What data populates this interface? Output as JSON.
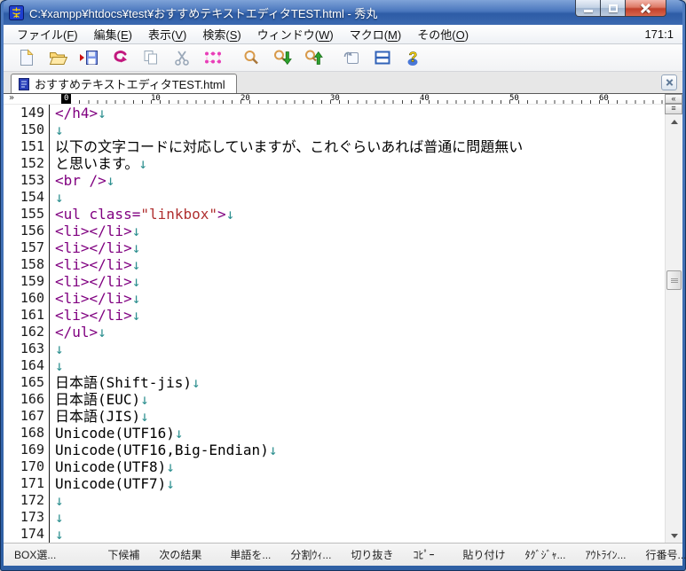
{
  "titlebar": {
    "title": "C:¥xampp¥htdocs¥test¥おすすめテキストエディタTEST.html  - 秀丸"
  },
  "menu": {
    "items": [
      {
        "id": "file",
        "pre": "ファイル(",
        "key": "F",
        "post": ")"
      },
      {
        "id": "edit",
        "pre": "編集(",
        "key": "E",
        "post": ")"
      },
      {
        "id": "view",
        "pre": "表示(",
        "key": "V",
        "post": ")"
      },
      {
        "id": "search",
        "pre": "検索(",
        "key": "S",
        "post": ")"
      },
      {
        "id": "window",
        "pre": "ウィンドウ(",
        "key": "W",
        "post": ")"
      },
      {
        "id": "macro",
        "pre": "マクロ(",
        "key": "M",
        "post": ")"
      },
      {
        "id": "other",
        "pre": "その他(",
        "key": "O",
        "post": ")"
      }
    ],
    "cursor_position": "171:1"
  },
  "toolbar": {
    "icons": [
      "new-file",
      "open-folder",
      "save",
      "undo",
      "copy",
      "cut",
      "box-select",
      "search",
      "search-down",
      "search-up",
      "tag-jump",
      "split-window",
      "help"
    ]
  },
  "tabbar": {
    "active_tab": "おすすめテキストエディタTEST.html"
  },
  "ruler": {
    "marks": [
      0,
      10,
      20,
      30,
      40,
      50,
      60
    ]
  },
  "editor": {
    "newline_glyph": "↓",
    "lines": [
      {
        "num": 149,
        "seg": [
          {
            "t": "</h4>",
            "c": "tag"
          }
        ],
        "nl": true
      },
      {
        "num": 150,
        "seg": [],
        "nl": true
      },
      {
        "num": 151,
        "seg": [
          {
            "t": "以下の文字コードに対応していますが、これぐらいあれば普通に問題無い",
            "c": "txt"
          }
        ],
        "nl": false
      },
      {
        "num": 152,
        "seg": [
          {
            "t": "と思います。",
            "c": "txt"
          }
        ],
        "nl": true
      },
      {
        "num": 153,
        "seg": [
          {
            "t": "<br />",
            "c": "tag"
          }
        ],
        "nl": true
      },
      {
        "num": 154,
        "seg": [],
        "nl": true
      },
      {
        "num": 155,
        "seg": [
          {
            "t": "<ul class=",
            "c": "tag"
          },
          {
            "t": "\"linkbox\"",
            "c": "str"
          },
          {
            "t": ">",
            "c": "tag"
          }
        ],
        "nl": true
      },
      {
        "num": 156,
        "seg": [
          {
            "t": "<li></li>",
            "c": "tag"
          }
        ],
        "nl": true
      },
      {
        "num": 157,
        "seg": [
          {
            "t": "<li></li>",
            "c": "tag"
          }
        ],
        "nl": true
      },
      {
        "num": 158,
        "seg": [
          {
            "t": "<li></li>",
            "c": "tag"
          }
        ],
        "nl": true
      },
      {
        "num": 159,
        "seg": [
          {
            "t": "<li></li>",
            "c": "tag"
          }
        ],
        "nl": true
      },
      {
        "num": 160,
        "seg": [
          {
            "t": "<li></li>",
            "c": "tag"
          }
        ],
        "nl": true
      },
      {
        "num": 161,
        "seg": [
          {
            "t": "<li></li>",
            "c": "tag"
          }
        ],
        "nl": true
      },
      {
        "num": 162,
        "seg": [
          {
            "t": "</ul>",
            "c": "tag"
          }
        ],
        "nl": true
      },
      {
        "num": 163,
        "seg": [],
        "nl": true
      },
      {
        "num": 164,
        "seg": [],
        "nl": true
      },
      {
        "num": 165,
        "seg": [
          {
            "t": "日本語(Shift-jis)",
            "c": "txt"
          }
        ],
        "nl": true
      },
      {
        "num": 166,
        "seg": [
          {
            "t": "日本語(EUC)",
            "c": "txt"
          }
        ],
        "nl": true
      },
      {
        "num": 167,
        "seg": [
          {
            "t": "日本語(JIS)",
            "c": "txt"
          }
        ],
        "nl": true
      },
      {
        "num": 168,
        "seg": [
          {
            "t": "Unicode(UTF16)",
            "c": "txt"
          }
        ],
        "nl": true
      },
      {
        "num": 169,
        "seg": [
          {
            "t": "Unicode(UTF16,Big-Endian)",
            "c": "txt"
          }
        ],
        "nl": true
      },
      {
        "num": 170,
        "seg": [
          {
            "t": "Unicode(UTF8)",
            "c": "txt"
          }
        ],
        "nl": true
      },
      {
        "num": 171,
        "seg": [
          {
            "t": "Unicode(UTF7)",
            "c": "txt"
          }
        ],
        "nl": true
      },
      {
        "num": 172,
        "seg": [],
        "nl": true
      },
      {
        "num": 173,
        "seg": [],
        "nl": true
      },
      {
        "num": 174,
        "seg": [],
        "nl": true
      }
    ]
  },
  "statusbar": {
    "items": [
      "BOX選...",
      "下候補",
      "次の結果",
      "|",
      "単語を...",
      "分割ｳｨ...",
      "切り抜き",
      "ｺﾋﾟｰ",
      "|",
      "貼り付け",
      "ﾀｸﾞｼﾞｬ...",
      "ｱｳﾄﾗｲﾝ...",
      "行番号..."
    ]
  },
  "colors": {
    "tag": "#800080",
    "string": "#b03030",
    "text": "#000000",
    "newline": "#2e9090",
    "line_number": "#1a1a1a",
    "titlebar_blue": "#2e5fa3"
  }
}
